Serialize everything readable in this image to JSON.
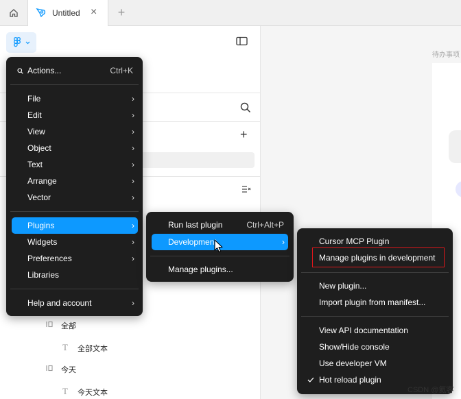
{
  "tabs": {
    "home_icon": "home-icon",
    "document_title": "Untitled",
    "close_icon": "close-icon",
    "new_tab_label": "+"
  },
  "left_panel": {
    "layers": [
      {
        "icon": "frame-icon",
        "label": "全部"
      },
      {
        "icon": "text-icon",
        "label": "全部文本"
      },
      {
        "icon": "frame-icon",
        "label": "今天"
      },
      {
        "icon": "text-icon",
        "label": "今天文本"
      }
    ]
  },
  "canvas": {
    "frame_label": "待办事项"
  },
  "main_menu": {
    "actions": {
      "label": "Actions...",
      "shortcut": "Ctrl+K"
    },
    "items": [
      {
        "label": "File",
        "has_submenu": true
      },
      {
        "label": "Edit",
        "has_submenu": true
      },
      {
        "label": "View",
        "has_submenu": true
      },
      {
        "label": "Object",
        "has_submenu": true
      },
      {
        "label": "Text",
        "has_submenu": true
      },
      {
        "label": "Arrange",
        "has_submenu": true
      },
      {
        "label": "Vector",
        "has_submenu": true
      },
      {
        "label": "Plugins",
        "has_submenu": true,
        "highlighted": true
      },
      {
        "label": "Widgets",
        "has_submenu": true
      },
      {
        "label": "Preferences",
        "has_submenu": true
      },
      {
        "label": "Libraries",
        "has_submenu": false
      },
      {
        "label": "Help and account",
        "has_submenu": true
      }
    ]
  },
  "plugins_menu": {
    "run_last": {
      "label": "Run last plugin",
      "shortcut": "Ctrl+Alt+P"
    },
    "development": {
      "label": "Development"
    },
    "manage": {
      "label": "Manage plugins..."
    }
  },
  "development_menu": {
    "items": [
      {
        "label": "Cursor MCP Plugin"
      },
      {
        "label": "Manage plugins in development"
      },
      {
        "label": "New plugin..."
      },
      {
        "label": "Import plugin from manifest..."
      },
      {
        "label": "View API documentation"
      },
      {
        "label": "Show/Hide console"
      },
      {
        "label": "Use developer VM"
      },
      {
        "label": "Hot reload plugin",
        "checked": true
      }
    ]
  },
  "watermark": "CSDN @氦客",
  "colors": {
    "menu_bg": "#1e1e1e",
    "highlight": "#0d99ff",
    "annotation_box": "#e0161b"
  }
}
